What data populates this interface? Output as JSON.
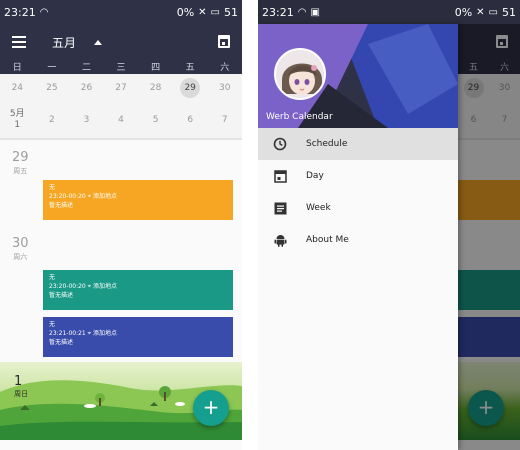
{
  "left_screen": {
    "status_bar": {
      "time": "23:21",
      "right": "0%",
      "battery": "51"
    },
    "toolbar": {
      "month_label": "五月"
    },
    "week_header": [
      "日",
      "一",
      "二",
      "三",
      "四",
      "五",
      "六"
    ],
    "week_row_1": [
      "24",
      "25",
      "26",
      "27",
      "28",
      "29",
      "30"
    ],
    "week_row_2": {
      "first_month": "5月",
      "first_day": "1",
      "days": [
        "2",
        "3",
        "4",
        "5",
        "6",
        "7"
      ]
    },
    "schedule": {
      "days": [
        {
          "number": "29",
          "weekday": "周五"
        },
        {
          "number": "30",
          "weekday": "周六"
        }
      ],
      "events": [
        {
          "title": "无",
          "time": "23:20-00:20",
          "location": "添加地点",
          "desc": "暂无描述",
          "color": "#f6a623"
        },
        {
          "title": "无",
          "time": "23:20-00:20",
          "location": "添加地点",
          "desc": "暂无描述",
          "color": "#1a9986"
        },
        {
          "title": "无",
          "time": "23:21-00:21",
          "location": "添加地点",
          "desc": "暂无描述",
          "color": "#3a4cab"
        }
      ]
    },
    "footer": {
      "day_number": "1",
      "weekday": "周日"
    },
    "fab": {
      "label": "+",
      "color": "#149f8e"
    }
  },
  "right_screen": {
    "status_bar": {
      "time": "23:21",
      "right": "0%",
      "battery": "51"
    },
    "drawer": {
      "app_title": "Werb Calendar",
      "menu": [
        {
          "label": "Schedule",
          "icon": "clock-icon",
          "active": true
        },
        {
          "label": "Day",
          "icon": "calendar-day-icon",
          "active": false
        },
        {
          "label": "Week",
          "icon": "list-icon",
          "active": false
        },
        {
          "label": "About Me",
          "icon": "android-icon",
          "active": false
        }
      ]
    },
    "peek": {
      "week_header": [
        "五",
        "六"
      ],
      "row_1": [
        "29",
        "30"
      ],
      "row_2": [
        "6",
        "7"
      ],
      "fab_label": "+"
    }
  },
  "colors": {
    "primary_dark": "#2f3146",
    "header_purple": "#7b62c8",
    "header_blue": "#3447b0"
  }
}
